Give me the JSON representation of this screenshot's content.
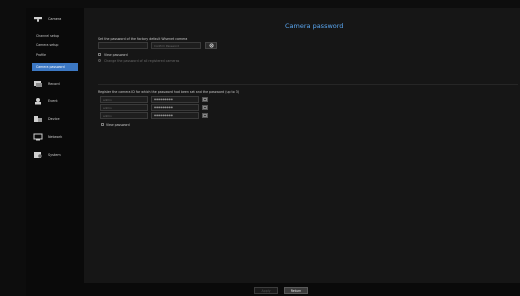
{
  "sidebar": {
    "categories": [
      {
        "label": "Camera",
        "icon": "camera-icon"
      },
      {
        "label": "Record",
        "icon": "record-icon"
      },
      {
        "label": "Event",
        "icon": "event-icon"
      },
      {
        "label": "Device",
        "icon": "device-icon"
      },
      {
        "label": "Network",
        "icon": "network-icon"
      },
      {
        "label": "System",
        "icon": "system-icon"
      }
    ],
    "camera_subitems": [
      "Channel setup",
      "Camera setup",
      "Profile",
      "Camera password"
    ],
    "active_subitem": "Camera password"
  },
  "main": {
    "title": "Camera password",
    "factory_section_label": "Set the password of the factory default Wisenet camera",
    "confirm_placeholder": "Confirm Password",
    "view_password_label": "View password",
    "change_all_label": "Change the password of all registered cameras",
    "register_label": "Register the camera ID for which the password had been set and the password (up to 3)",
    "register_rows": [
      {
        "id": "admin",
        "password": "●●●●●●●●●"
      },
      {
        "id": "admin",
        "password": "●●●●●●●●●"
      },
      {
        "id": "admin",
        "password": "●●●●●●●●●"
      }
    ],
    "view_password_label_2": "View password"
  },
  "footer": {
    "apply_label": "Apply",
    "return_label": "Return"
  },
  "colors": {
    "accent": "#3c78c4",
    "title": "#5aa6f0"
  }
}
